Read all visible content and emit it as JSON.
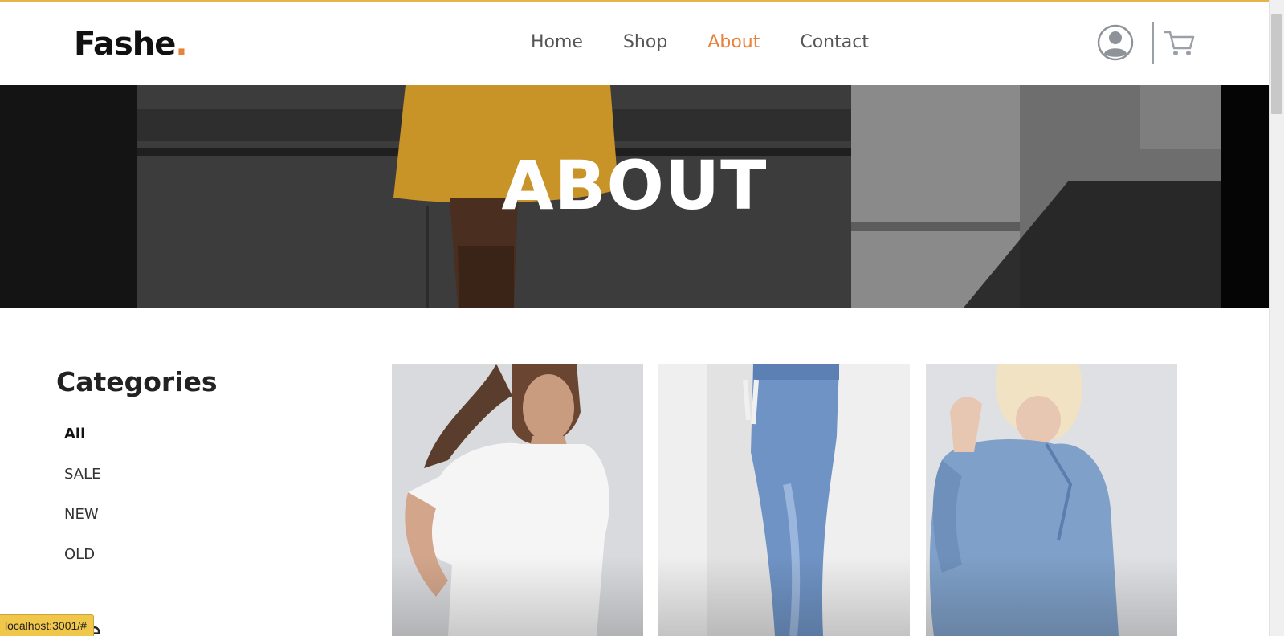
{
  "header": {
    "logo_text": "Fashe",
    "logo_dot": ".",
    "nav": [
      {
        "label": "Home",
        "active": false
      },
      {
        "label": "Shop",
        "active": false
      },
      {
        "label": "About",
        "active": true
      },
      {
        "label": "Contact",
        "active": false
      }
    ],
    "icons": [
      "user-icon",
      "cart-icon"
    ],
    "accent_color": "#e8823a"
  },
  "hero": {
    "title": "ABOUT"
  },
  "sidebar": {
    "title": "Categories",
    "items": [
      {
        "label": "All",
        "active": true
      },
      {
        "label": "SALE",
        "active": false
      },
      {
        "label": "NEW",
        "active": false
      },
      {
        "label": "OLD",
        "active": false
      }
    ]
  },
  "products": [
    {
      "image": "white-tshirt-photo"
    },
    {
      "image": "blue-jeans-photo"
    },
    {
      "image": "denim-jacket-photo"
    }
  ],
  "status_bar": {
    "link": "localhost:3001/#"
  }
}
